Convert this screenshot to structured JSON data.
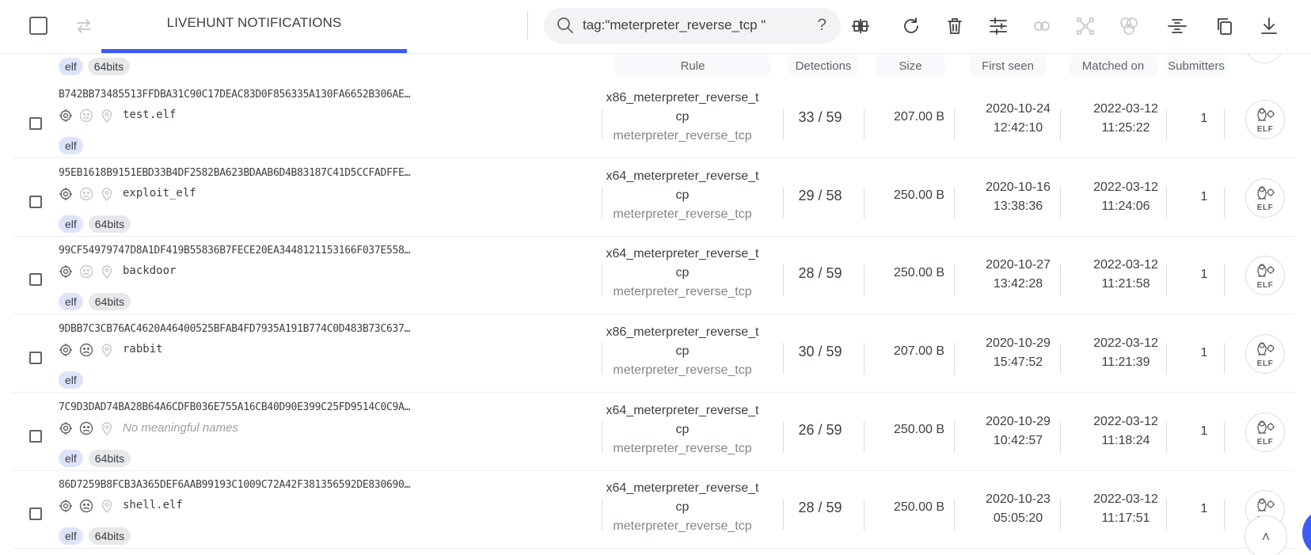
{
  "toolbar": {
    "tab_title": "LIVEHUNT NOTIFICATIONS",
    "search_query": "tag:\"meterpreter_reverse_tcp \"",
    "help_label": "?",
    "tools": [
      "compare-icon",
      "refresh-icon",
      "trash-icon",
      "sliders-icon",
      "link-icon",
      "network-icon",
      "circles-icon",
      "strikethrough-icon",
      "copy-icon",
      "download-icon"
    ]
  },
  "table": {
    "columns": {
      "rule": "Rule",
      "detections": "Detections",
      "size": "Size",
      "first_seen": "First seen",
      "matched_on": "Matched on",
      "submitters": "Submitters"
    },
    "header_tags": [
      "elf",
      "64bits"
    ],
    "rows": [
      {
        "hash": "B742BB73485513FFDBA31C90C17DEAC83D0F856335A130FA6652B306AE…",
        "name": "test.elf",
        "tags": [
          "elf"
        ],
        "rule": "x86_meterpreter_reverse_tcp",
        "ruleset": "meterpreter_reverse_tcp",
        "detections": "33 / 59",
        "size": "207.00 B",
        "first_seen_date": "2020-10-24",
        "first_seen_time": "12:42:10",
        "matched_date": "2022-03-12",
        "matched_time": "11:25:22",
        "submitters": "1"
      },
      {
        "hash": "95EB1618B9151EBD33B4DF2582BA623BDAAB6D4B83187C41D5CCFADFFE…",
        "name": "exploit_elf",
        "tags": [
          "elf",
          "64bits"
        ],
        "rule": "x64_meterpreter_reverse_tcp",
        "ruleset": "meterpreter_reverse_tcp",
        "detections": "29 / 58",
        "size": "250.00 B",
        "first_seen_date": "2020-10-16",
        "first_seen_time": "13:38:36",
        "matched_date": "2022-03-12",
        "matched_time": "11:24:06",
        "submitters": "1"
      },
      {
        "hash": "99CF54979747D8A1DF419B55836B7FECE20EA3448121153166F037E558…",
        "name": "backdoor",
        "tags": [
          "elf",
          "64bits"
        ],
        "rule": "x64_meterpreter_reverse_tcp",
        "ruleset": "meterpreter_reverse_tcp",
        "detections": "28 / 59",
        "size": "250.00 B",
        "first_seen_date": "2020-10-27",
        "first_seen_time": "13:42:28",
        "matched_date": "2022-03-12",
        "matched_time": "11:21:58",
        "submitters": "1"
      },
      {
        "hash": "9DBB7C3CB76AC4620A46400525BFAB4FD7935A191B774C0D483B73C637…",
        "name": "rabbit",
        "tags": [
          "elf"
        ],
        "rule": "x86_meterpreter_reverse_tcp",
        "ruleset": "meterpreter_reverse_tcp",
        "detections": "30 / 59",
        "size": "207.00 B",
        "first_seen_date": "2020-10-29",
        "first_seen_time": "15:47:52",
        "matched_date": "2022-03-12",
        "matched_time": "11:21:39",
        "submitters": "1"
      },
      {
        "hash": "7C9D3DAD74BA28B64A6CDFB036E755A16CB40D90E399C25FD9514C0C9A…",
        "name": "No meaningful names",
        "name_muted": true,
        "tags": [
          "elf",
          "64bits"
        ],
        "rule": "x64_meterpreter_reverse_tcp",
        "ruleset": "meterpreter_reverse_tcp",
        "detections": "26 / 59",
        "size": "250.00 B",
        "first_seen_date": "2020-10-29",
        "first_seen_time": "10:42:57",
        "matched_date": "2022-03-12",
        "matched_time": "11:18:24",
        "submitters": "1"
      },
      {
        "hash": "86D7259B8FCB3A365DEF6AAB99193C1009C72A42F381356592DE830690…",
        "name": "shell.elf",
        "tags": [
          "elf",
          "64bits"
        ],
        "rule": "x64_meterpreter_reverse_tcp",
        "ruleset": "meterpreter_reverse_tcp",
        "detections": "28 / 59",
        "size": "250.00 B",
        "first_seen_date": "2020-10-23",
        "first_seen_time": "05:05:20",
        "matched_date": "2022-03-12",
        "matched_time": "11:17:51",
        "submitters": "1"
      }
    ]
  },
  "badge_label": "ELF",
  "scroll_top_label": "˄",
  "colors": {
    "accent": "#3b5bf5",
    "elf_tag": "#dde3fb",
    "bits_tag": "#e6e8ea"
  }
}
